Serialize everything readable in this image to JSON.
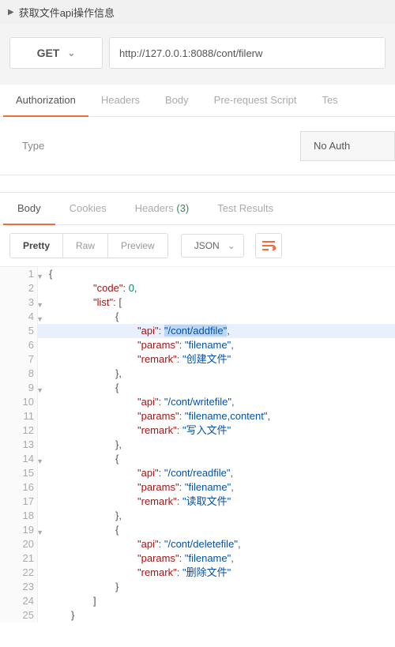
{
  "title": "获取文件api操作信息",
  "request": {
    "method": "GET",
    "url": "http://127.0.0.1:8088/cont/filerw"
  },
  "tabs_request": {
    "authorization": "Authorization",
    "headers": "Headers",
    "body": "Body",
    "prerequest": "Pre-request Script",
    "tests": "Tes"
  },
  "auth": {
    "type_label": "Type",
    "value": "No Auth"
  },
  "tabs_response": {
    "body": "Body",
    "cookies": "Cookies",
    "headers": "Headers",
    "headers_count": "(3)",
    "test_results": "Test Results"
  },
  "toolbar": {
    "pretty": "Pretty",
    "raw": "Raw",
    "preview": "Preview",
    "format": "JSON"
  },
  "json": {
    "key_code": "code",
    "val_code": "0",
    "key_list": "list",
    "key_api": "api",
    "key_params": "params",
    "key_remark": "remark",
    "items": [
      {
        "api": "/cont/addfile",
        "params": "filename",
        "remark": "创建文件"
      },
      {
        "api": "/cont/writefile",
        "params": "filename,content",
        "remark": "写入文件"
      },
      {
        "api": "/cont/readfile",
        "params": "filename",
        "remark": "读取文件"
      },
      {
        "api": "/cont/deletefile",
        "params": "filename",
        "remark": "删除文件"
      }
    ]
  },
  "lineno": {
    "l1": "1",
    "l2": "2",
    "l3": "3",
    "l4": "4",
    "l5": "5",
    "l6": "6",
    "l7": "7",
    "l8": "8",
    "l9": "9",
    "l10": "10",
    "l11": "11",
    "l12": "12",
    "l13": "13",
    "l14": "14",
    "l15": "15",
    "l16": "16",
    "l17": "17",
    "l18": "18",
    "l19": "19",
    "l20": "20",
    "l21": "21",
    "l22": "22",
    "l23": "23",
    "l24": "24",
    "l25": "25"
  }
}
